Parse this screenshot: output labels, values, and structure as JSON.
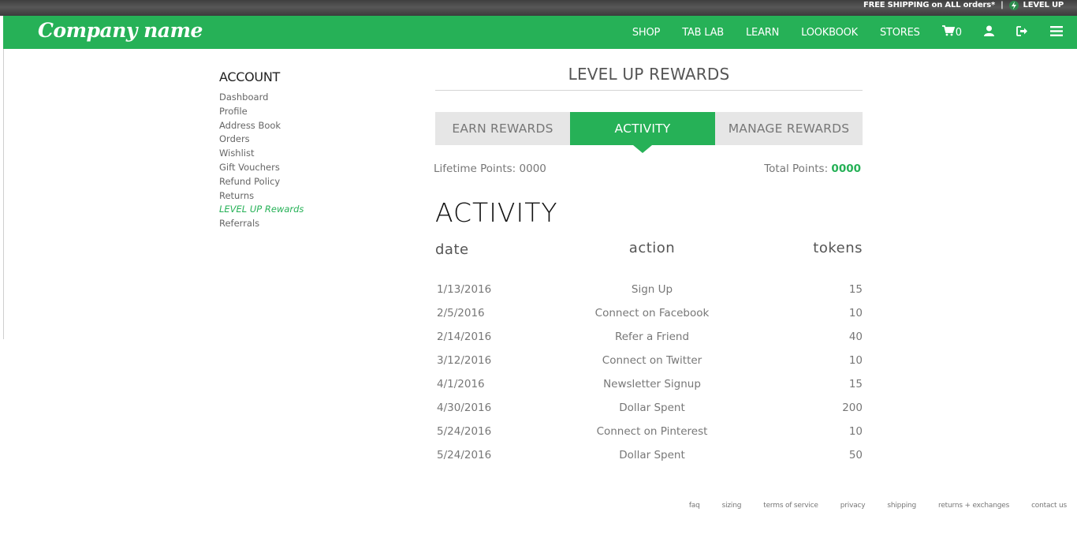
{
  "promo": {
    "shipping_text": "FREE SHIPPING on ALL orders*",
    "separator": "|",
    "level_up_label": "LEVEL UP"
  },
  "header": {
    "logo": "Company name",
    "nav": [
      "SHOP",
      "TAB LAB",
      "LEARN",
      "LOOKBOOK",
      "STORES"
    ],
    "cart_count": "0",
    "icons": [
      "cart-icon",
      "user-icon",
      "sign-out-icon",
      "menu-icon"
    ]
  },
  "sidebar": {
    "title": "ACCOUNT",
    "items": [
      {
        "label": "Dashboard"
      },
      {
        "label": "Profile"
      },
      {
        "label": "Address Book"
      },
      {
        "label": "Orders"
      },
      {
        "label": "Wishlist"
      },
      {
        "label": "Gift Vouchers"
      },
      {
        "label": "Refund Policy"
      },
      {
        "label": "Returns"
      },
      {
        "label": "LEVEL UP Rewards",
        "active": true
      },
      {
        "label": "Referrals"
      }
    ]
  },
  "main": {
    "title": "LEVEL UP REWARDS",
    "tabs": [
      {
        "label": "EARN REWARDS"
      },
      {
        "label": "ACTIVITY",
        "active": true
      },
      {
        "label": "MANAGE REWARDS"
      }
    ],
    "lifetime_label": "Lifetime Points: 0000",
    "total_label": "Total Points: ",
    "total_value": "0000",
    "section_heading": "ACTIVITY",
    "table": {
      "headers": [
        "date",
        "action",
        "tokens"
      ],
      "rows": [
        [
          "1/13/2016",
          "Sign Up",
          "15"
        ],
        [
          "2/5/2016",
          "Connect on Facebook",
          "10"
        ],
        [
          "2/14/2016",
          "Refer a Friend",
          "40"
        ],
        [
          "3/12/2016",
          "Connect on Twitter",
          "10"
        ],
        [
          "4/1/2016",
          "Newsletter Signup",
          "15"
        ],
        [
          "4/30/2016",
          "Dollar Spent",
          "200"
        ],
        [
          "5/24/2016",
          "Connect on Pinterest",
          "10"
        ],
        [
          "5/24/2016",
          "Dollar Spent",
          "50"
        ]
      ]
    }
  },
  "footer": {
    "links": [
      "faq",
      "sizing",
      "terms of service",
      "privacy",
      "shipping",
      "returns + exchanges",
      "contact us"
    ]
  },
  "colors": {
    "brand_green": "#26b157",
    "tab_gray": "#e6e6e6"
  }
}
